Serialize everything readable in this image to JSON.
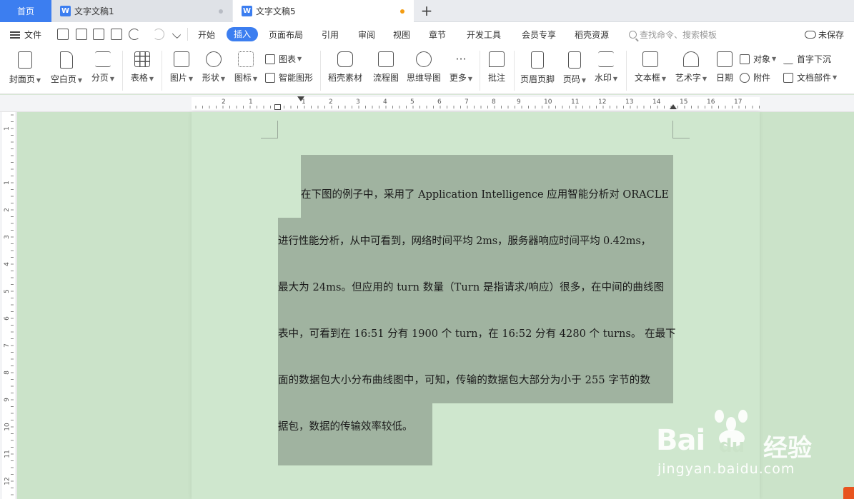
{
  "tabs": {
    "home": "首页",
    "doc1": "文字文稿1",
    "doc2": "文字文稿5",
    "add": "+"
  },
  "menu": {
    "file": "文件",
    "tabs": [
      "开始",
      "插入",
      "页面布局",
      "引用",
      "审阅",
      "视图",
      "章节",
      "开发工具",
      "会员专享",
      "稻壳资源"
    ],
    "active_tab": "插入",
    "search_placeholder": "查找命令、搜索模板",
    "unsaved": "未保存"
  },
  "ribbon": {
    "cover": "封面页",
    "blank": "空白页",
    "break": "分页",
    "table": "表格",
    "picture": "图片",
    "shape": "形状",
    "icon": "图标",
    "chart": "图表",
    "smart": "智能图形",
    "material": "稻壳素材",
    "flow": "流程图",
    "mindmap": "思维导图",
    "more": "更多",
    "comment": "批注",
    "header": "页眉页脚",
    "pagenum": "页码",
    "watermark": "水印",
    "textbox": "文本框",
    "art": "艺术字",
    "date": "日期",
    "object": "对象",
    "attach": "附件",
    "dropcap": "首字下沉",
    "parts": "文档部件"
  },
  "ruler": {
    "top_numbers": [
      "2",
      "1",
      "1",
      "2",
      "3",
      "4",
      "5",
      "6",
      "7",
      "8",
      "9",
      "10",
      "11",
      "12",
      "13",
      "14",
      "15",
      "16",
      "17"
    ],
    "left_numbers": [
      "1",
      "1",
      "2",
      "3",
      "4",
      "5",
      "6",
      "7",
      "8",
      "9",
      "10",
      "11",
      "12"
    ]
  },
  "document": {
    "lines": [
      "在下图的例子中，采用了 Application Intelligence 应用智能分析对 ORACLE",
      "进行性能分析，从中可看到，网络时间平均 2ms，服务器响应时间平均 0.42ms，",
      "最大为 24ms。但应用的 turn 数量（Turn 是指请求/响应）很多，在中间的曲线图",
      "表中，可看到在 16:51 分有 1900 个 turn，在 16:52 分有 4280 个 turns。 在最下",
      "面的数据包大小分布曲线图中，可知，传输的数据包大部分为小于 255 字节的数",
      "据包，数据的传输效率较低。"
    ]
  },
  "watermark": {
    "brand": "Bai",
    "du": "du",
    "jingyan": "经验",
    "url": "jingyan.baidu.com"
  }
}
